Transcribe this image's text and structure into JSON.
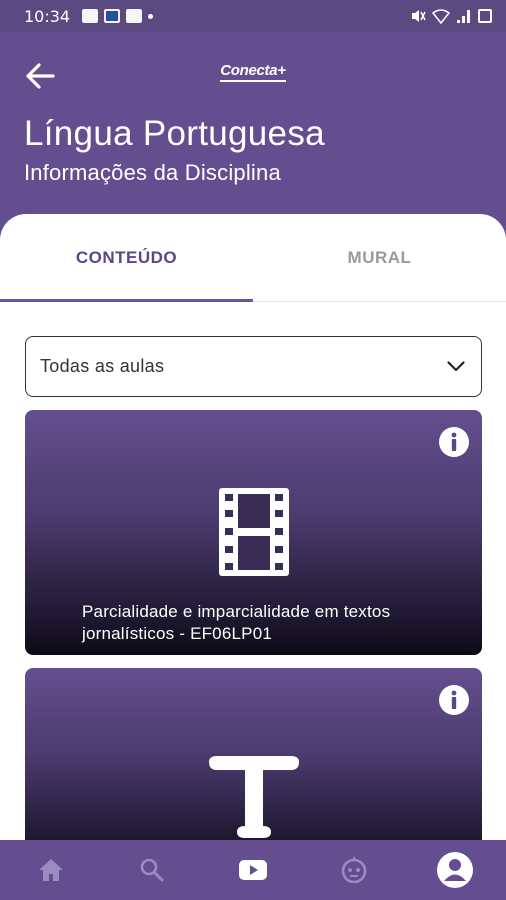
{
  "status": {
    "time": "10:34"
  },
  "header": {
    "brand": "Conecta+",
    "title": "Língua Portuguesa",
    "subtitle": "Informações da Disciplina"
  },
  "tabs": [
    {
      "label": "CONTEÚDO",
      "active": true
    },
    {
      "label": "MURAL",
      "active": false
    }
  ],
  "filter": {
    "selected": "Todas as aulas"
  },
  "cards": [
    {
      "icon": "film-icon",
      "title": "Parcialidade e imparcialidade em textos jornalísticos - EF06LP01"
    },
    {
      "icon": "text-icon",
      "title": ""
    }
  ],
  "bottom_nav": [
    {
      "icon": "home-icon"
    },
    {
      "icon": "search-icon"
    },
    {
      "icon": "youtube-icon"
    },
    {
      "icon": "robot-icon"
    },
    {
      "icon": "profile-icon",
      "active": true
    }
  ],
  "colors": {
    "primary": "#654e8f",
    "accent": "#5a4585"
  }
}
